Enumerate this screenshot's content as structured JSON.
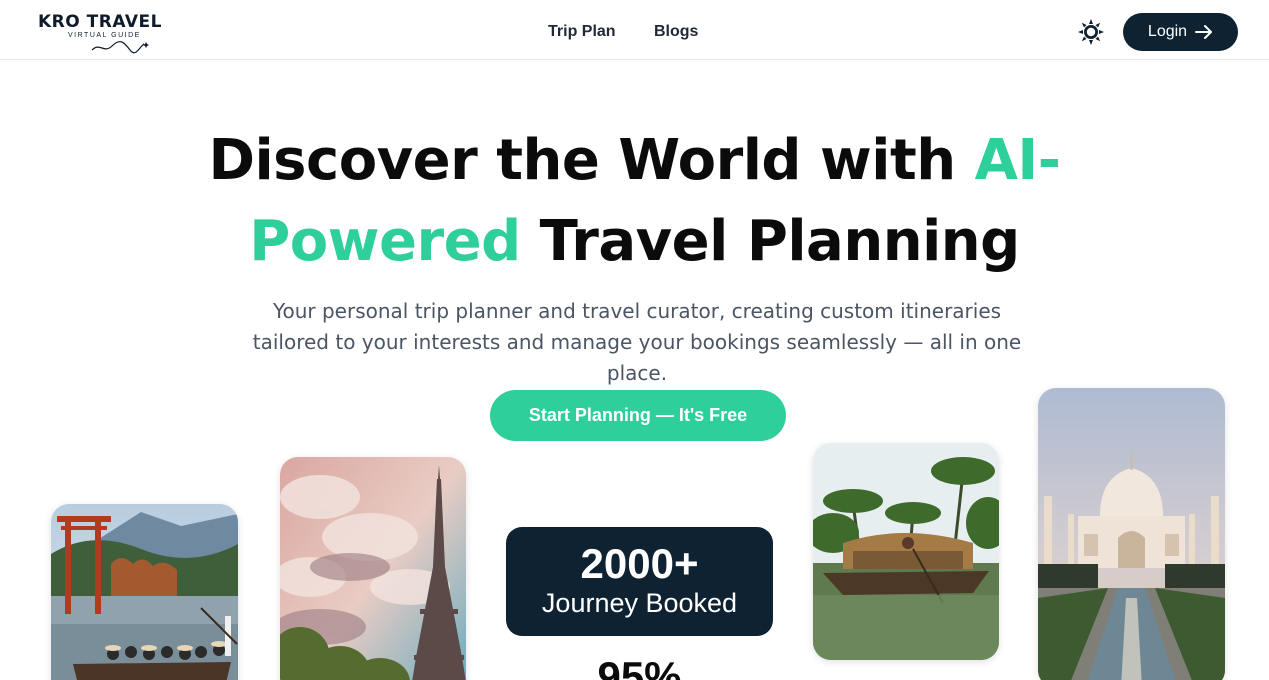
{
  "brand": {
    "name": "KRO TRAVEL",
    "tagline": "VIRTUAL GUIDE"
  },
  "nav": {
    "links": [
      {
        "label": "Trip Plan"
      },
      {
        "label": "Blogs"
      }
    ],
    "theme_toggle_icon": "sun-icon",
    "login_label": "Login",
    "login_icon": "arrow-right-icon"
  },
  "hero": {
    "title_part1": "Discover the World with ",
    "title_accent1": "AI-",
    "title_accent2": "Powered",
    "title_part2": " Travel Planning",
    "subtitle": "Your personal trip planner and travel curator, creating custom itineraries tailored to your interests and manage your bookings seamlessly — all in one place.",
    "cta_label": "Start Planning — It's Free"
  },
  "stats": [
    {
      "value": "2000+",
      "label": "Journey Booked"
    },
    {
      "value": "95%"
    }
  ],
  "colors": {
    "accent": "#2ecf9a",
    "dark": "#0f2232",
    "text_muted": "#4b5563"
  }
}
